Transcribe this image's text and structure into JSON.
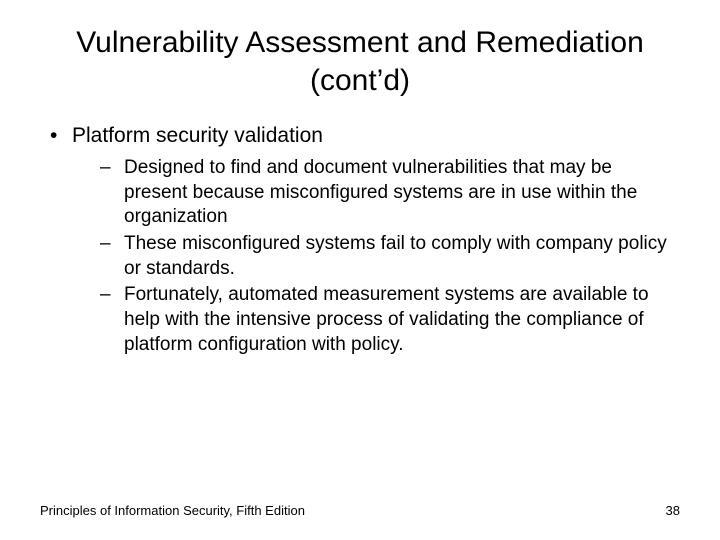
{
  "title": "Vulnerability Assessment and Remediation (cont’d)",
  "bullets": {
    "level1": [
      {
        "text": "Platform security validation",
        "sub": [
          "Designed to find and document vulnerabilities that may be present because misconfigured systems are in use within the organization",
          "These misconfigured systems fail to comply with company policy or standards.",
          "Fortunately, automated measurement systems are available to help with the intensive process of validating the compliance of platform configuration with policy."
        ]
      }
    ]
  },
  "footer": {
    "source": "Principles of Information Security, Fifth Edition",
    "page": "38"
  }
}
